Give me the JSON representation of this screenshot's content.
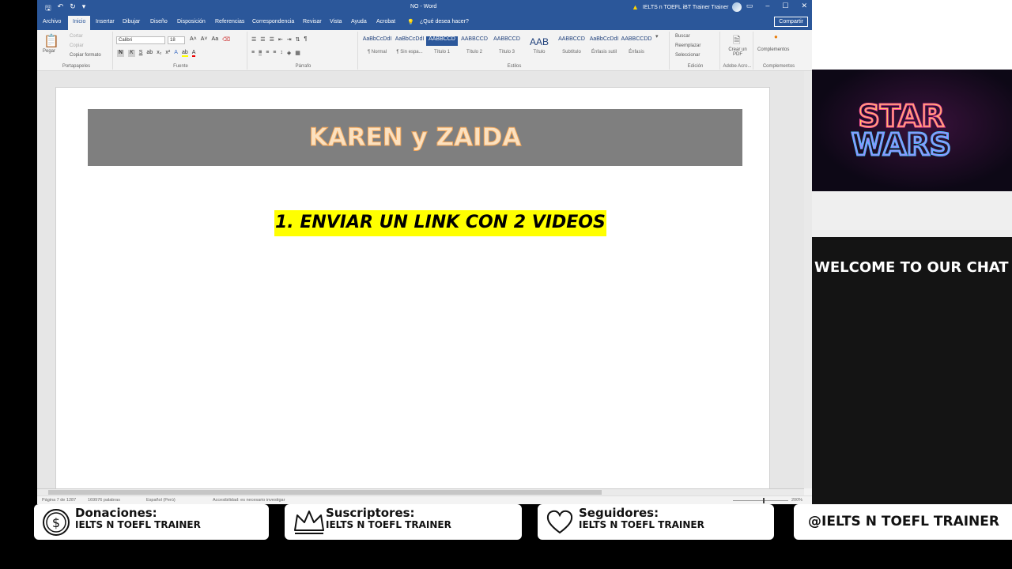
{
  "word": {
    "doc_title": "NO - Word",
    "account_name": "IELTS n TOEFL iBT Trainer Trainer",
    "tabs": [
      "Archivo",
      "Inicio",
      "Insertar",
      "Dibujar",
      "Diseño",
      "Disposición",
      "Referencias",
      "Correspondencia",
      "Revisar",
      "Vista",
      "Ayuda",
      "Acrobat"
    ],
    "tell_me": "¿Qué desea hacer?",
    "share": "Compartir",
    "clipboard": {
      "paste": "Pegar",
      "cut": "Cortar",
      "copy": "Copiar",
      "format_painter": "Copiar formato",
      "label": "Portapapeles"
    },
    "font": {
      "name": "Calibri",
      "size": "18",
      "label": "Fuente",
      "bold": "N",
      "italic": "K",
      "underline": "S"
    },
    "paragraph_label": "Párrafo",
    "styles": [
      {
        "preview": "AaBbCcDdI",
        "name": "¶ Normal"
      },
      {
        "preview": "AaBbCcDdI",
        "name": "¶ Sin espa..."
      },
      {
        "preview": "AABBCCD",
        "name": "Título 1"
      },
      {
        "preview": "AABBCCD",
        "name": "Título 2"
      },
      {
        "preview": "AABBCCD",
        "name": "Título 3"
      },
      {
        "preview": "AAB",
        "name": "Título"
      },
      {
        "preview": "AABBCCD",
        "name": "Subtítulo"
      },
      {
        "preview": "AaBbCcDdI",
        "name": "Énfasis sutil"
      },
      {
        "preview": "AABBCCDD",
        "name": "Énfasis"
      }
    ],
    "styles_label": "Estilos",
    "editing": {
      "find": "Buscar",
      "replace": "Reemplazar",
      "select": "Seleccionar",
      "label": "Edición"
    },
    "adobe": {
      "create_pdf": "Crear un PDF",
      "label": "Adobe Acro..."
    },
    "addins": {
      "button": "Complementos",
      "label": "Complementos"
    },
    "document": {
      "banner": "KAREN y ZAIDA",
      "item_1": "1. ENVIAR UN LINK CON 2 VIDEOS"
    },
    "status": {
      "page": "Página 7 de 1287",
      "words": "169976 palabras",
      "language": "Español (Perú)",
      "accessibility": "Accesibilidad: es necesario investigar",
      "zoom": "200%"
    }
  },
  "overlay": {
    "logo_line1": "STAR",
    "logo_line2": "WARS",
    "chat_title": "WELCOME TO OUR CHAT",
    "cards": [
      {
        "label": "Donaciones:",
        "sub": "IELTS N TOEFL TRAINER",
        "icon": "dollar-coin-icon"
      },
      {
        "label": "Suscriptores:",
        "sub": "IELTS N TOEFL TRAINER",
        "icon": "crown-icon"
      },
      {
        "label": "Seguidores:",
        "sub": "IELTS N TOEFL TRAINER",
        "icon": "heart-icon"
      }
    ],
    "handle": "@IELTS N TOEFL TRAINER"
  }
}
